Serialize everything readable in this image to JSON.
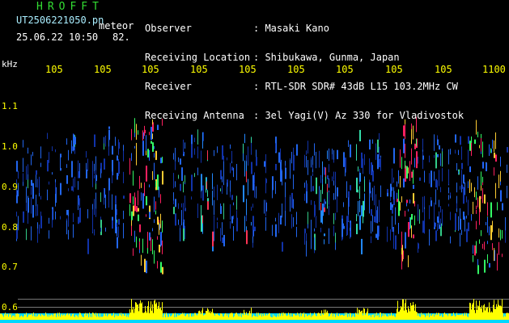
{
  "header": {
    "app_title": "HROFFT",
    "filename": "UT2506221050.pn",
    "meteor_label": "meteor",
    "timestamp": "25.06.22 10:50",
    "count": "82."
  },
  "info": {
    "labels": [
      "Observer",
      "Receiving Location",
      "Receiver",
      "Receiving Antenna"
    ],
    "values": [
      ": Masaki Kano",
      ": Shibukawa, Gunma, Japan",
      ": RTL-SDR SDR# 43dB L15 103.2MHz CW",
      ": 3el Yagi(V) Az 330 for Vladivostok"
    ]
  },
  "axis": {
    "y_unit": "kHz",
    "y_ticks": [
      "1.1",
      "1.0",
      "0.9",
      "0.8",
      "0.7",
      "0.6"
    ],
    "x_ticks": [
      "105",
      "105",
      "105",
      "105",
      "105",
      "105",
      "105",
      "105",
      "105",
      "1100"
    ]
  },
  "colors": {
    "background": "#000000",
    "text_green": "#33dd33",
    "text_white": "#ffffff",
    "tick_yellow": "#ffff00",
    "strip_cyan": "#00d8ff"
  }
}
